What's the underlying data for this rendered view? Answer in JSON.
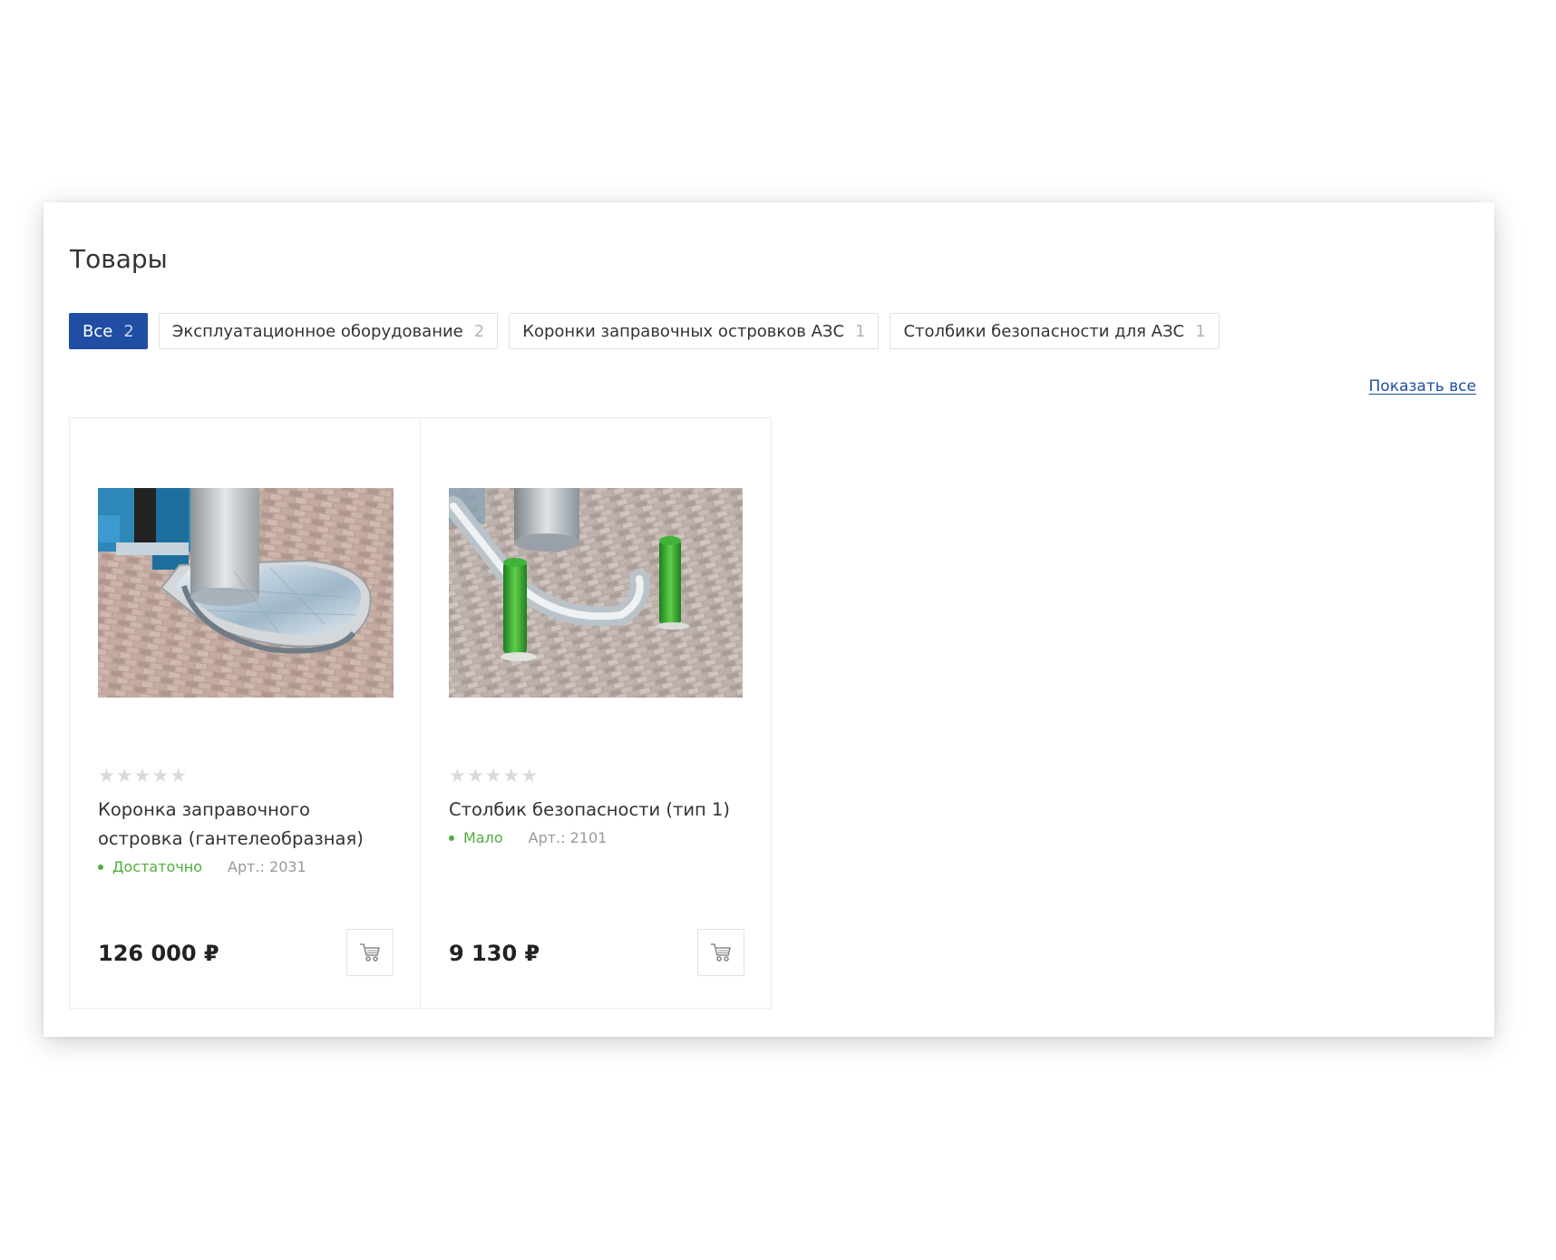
{
  "section": {
    "title": "Товары",
    "show_all_label": "Показать все"
  },
  "tabs": [
    {
      "label": "Все",
      "count": "2",
      "active": true
    },
    {
      "label": "Эксплуатационное оборудование",
      "count": "2",
      "active": false
    },
    {
      "label": "Коронки заправочных островков АЗС",
      "count": "1",
      "active": false
    },
    {
      "label": "Столбики безопасности для АЗС",
      "count": "1",
      "active": false
    }
  ],
  "products": [
    {
      "rating_stars": "★★★★★",
      "rating_value": 0,
      "name": "Коронка заправочного островка (гантелеобразная)",
      "stock": "Достаточно",
      "sku": "Арт.: 2031",
      "price": "126 000 ₽",
      "image_icon": "island-crown-photo",
      "cart_icon": "cart-icon"
    },
    {
      "rating_stars": "★★★★★",
      "rating_value": 0,
      "name": "Столбик безопасности (тип 1)",
      "stock": "Мало",
      "sku": "Арт.: 2101",
      "price": "9 130 ₽",
      "image_icon": "safety-bollard-photo",
      "cart_icon": "cart-icon"
    }
  ],
  "colors": {
    "accent": "#1f4ea3",
    "stock_green": "#4caf3a",
    "muted": "#999999"
  }
}
